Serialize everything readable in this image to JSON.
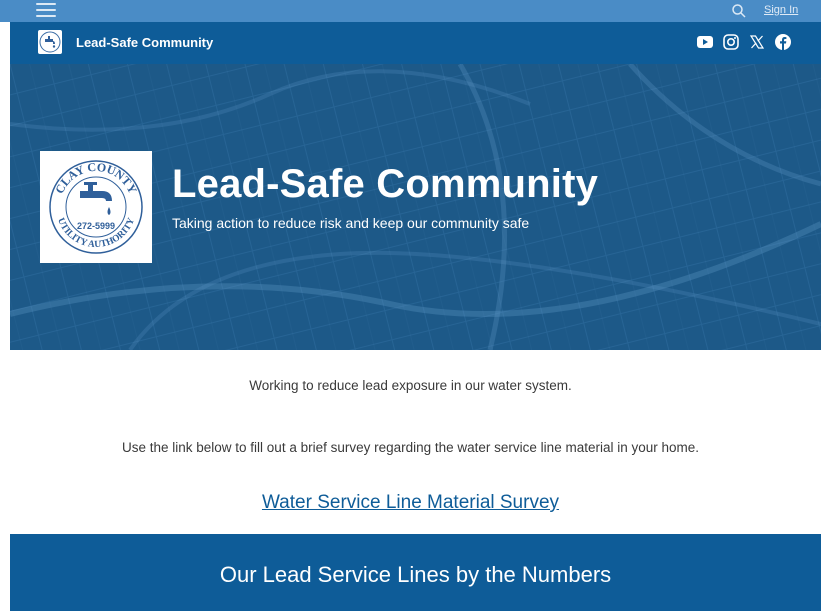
{
  "topbar": {
    "menu_icon": "hamburger-menu-icon",
    "search_icon": "search-icon",
    "sign_in_label": "Sign In"
  },
  "header": {
    "site_title": "Lead-Safe Community",
    "logo_icon": "utility-authority-logo",
    "social_icons": [
      "youtube-icon",
      "instagram-icon",
      "x-icon",
      "facebook-icon"
    ]
  },
  "hero": {
    "title": "Lead-Safe Community",
    "subtitle": "Taking action to reduce risk and keep our community safe",
    "logo": {
      "top_text": "CLAY COUNTY",
      "bottom_text": "UTILITY AUTHORITY",
      "phone": "272-5999"
    }
  },
  "content": {
    "intro": "Working to reduce lead exposure in our water system.",
    "survey_prompt": "Use the link below to fill out a brief survey regarding the water service line material in your home.",
    "survey_link": "Water Service Line Material Survey"
  },
  "numbers_section": {
    "title": "Our Lead Service Lines by the Numbers"
  },
  "colors": {
    "topbar": "#4a8cc6",
    "header": "#0e5c98",
    "hero": "#1d5988",
    "link": "#0e5c98"
  }
}
